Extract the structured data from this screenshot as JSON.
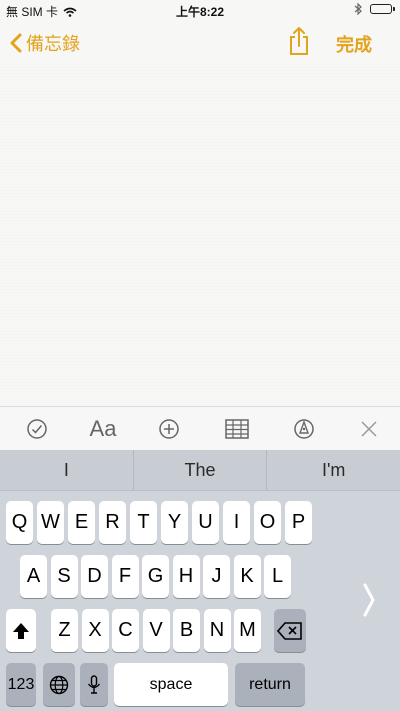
{
  "status": {
    "carrier": "無 SIM 卡",
    "time": "上午8:22"
  },
  "nav": {
    "back_label": "備忘錄",
    "done_label": "完成"
  },
  "suggestions": [
    "I",
    "The",
    "I'm"
  ],
  "keys": {
    "row1": [
      "Q",
      "W",
      "E",
      "R",
      "T",
      "Y",
      "U",
      "I",
      "O",
      "P"
    ],
    "row2": [
      "A",
      "S",
      "D",
      "F",
      "G",
      "H",
      "J",
      "K",
      "L"
    ],
    "row3": [
      "Z",
      "X",
      "C",
      "V",
      "B",
      "N",
      "M"
    ],
    "numbers": "123",
    "space": "space",
    "return": "return"
  },
  "icons": {
    "checklist": "check-circle-icon",
    "format": "Aa",
    "add": "plus-circle-icon",
    "table": "table-icon",
    "markup": "pen-circle-icon",
    "close": "close-icon"
  },
  "colors": {
    "accent": "#e3a31d"
  }
}
